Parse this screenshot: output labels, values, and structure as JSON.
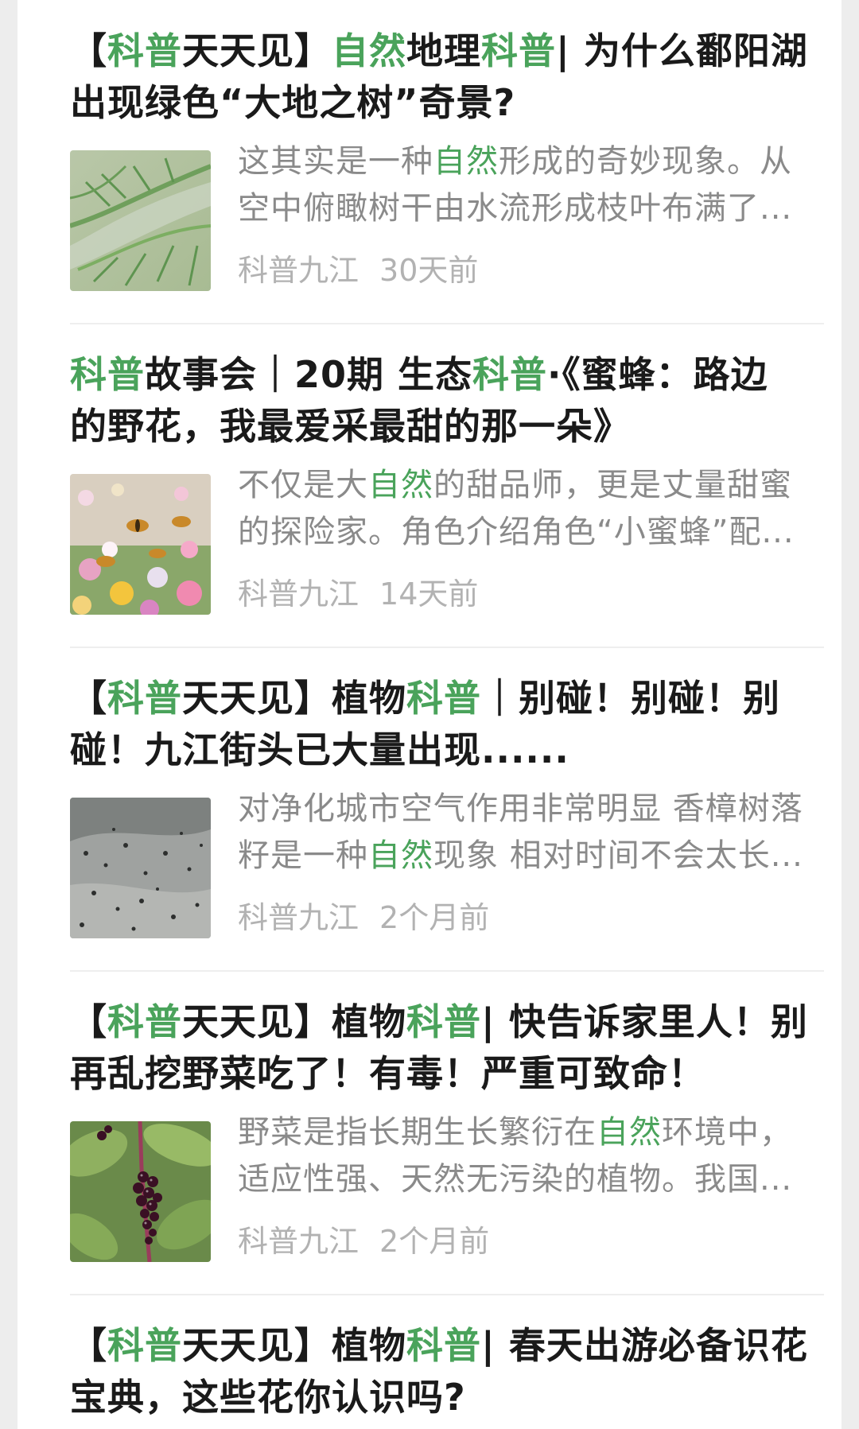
{
  "results": [
    {
      "title_lines": [
        [
          {
            "t": "【",
            "hl": false
          },
          {
            "t": "科普",
            "hl": true
          },
          {
            "t": "天天见】",
            "hl": false
          },
          {
            "t": "自然",
            "hl": true
          },
          {
            "t": "地理",
            "hl": false
          },
          {
            "t": "科普",
            "hl": true
          },
          {
            "t": "| 为什么鄱阳湖",
            "hl": false
          }
        ],
        [
          {
            "t": "出现绿色“大地之树”奇景?",
            "hl": false
          }
        ]
      ],
      "snippet_lines": [
        [
          {
            "t": "这其实是一种",
            "hl": false
          },
          {
            "t": "自然",
            "hl": true
          },
          {
            "t": "形成的奇妙现象。从",
            "hl": false
          }
        ],
        [
          {
            "t": "空中俯瞰树干由水流形成枝叶布满了...",
            "hl": false
          }
        ]
      ],
      "source": "科普九江",
      "time": "30天前",
      "thumbnail": "aerial-river-tree-pattern"
    },
    {
      "title_lines": [
        [
          {
            "t": "科普",
            "hl": true
          },
          {
            "t": "故事会｜20期 生态",
            "hl": false
          },
          {
            "t": "科普",
            "hl": true
          },
          {
            "t": "·《蜜蜂：路边",
            "hl": false
          }
        ],
        [
          {
            "t": "的野花，我最爱采最甜的那一朵》",
            "hl": false
          }
        ]
      ],
      "snippet_lines": [
        [
          {
            "t": "不仅是大",
            "hl": false
          },
          {
            "t": "自然",
            "hl": true
          },
          {
            "t": "的甜品师，更是丈量甜蜜",
            "hl": false
          }
        ],
        [
          {
            "t": "的探险家。角色介绍角色“小蜜蜂”配...",
            "hl": false
          }
        ]
      ],
      "source": "科普九江",
      "time": "14天前",
      "thumbnail": "bees-on-wildflowers"
    },
    {
      "title_lines": [
        [
          {
            "t": "【",
            "hl": false
          },
          {
            "t": "科普",
            "hl": true
          },
          {
            "t": "天天见】植物",
            "hl": false
          },
          {
            "t": "科普",
            "hl": true
          },
          {
            "t": "｜别碰！别碰！别",
            "hl": false
          }
        ],
        [
          {
            "t": "碰！九江街头已大量出现......",
            "hl": false
          }
        ]
      ],
      "snippet_lines": [
        [
          {
            "t": "对净化城市空气作用非常明显 香樟树落",
            "hl": false
          }
        ],
        [
          {
            "t": "籽是一种",
            "hl": false
          },
          {
            "t": "自然",
            "hl": true
          },
          {
            "t": "现象 相对时间不会太长...",
            "hl": false
          }
        ]
      ],
      "source": "科普九江",
      "time": "2个月前",
      "thumbnail": "seeds-on-pavement"
    },
    {
      "title_lines": [
        [
          {
            "t": "【",
            "hl": false
          },
          {
            "t": "科普",
            "hl": true
          },
          {
            "t": "天天见】植物",
            "hl": false
          },
          {
            "t": "科普",
            "hl": true
          },
          {
            "t": "| 快告诉家里人！别",
            "hl": false
          }
        ],
        [
          {
            "t": "再乱挖野菜吃了！有毒！严重可致命！",
            "hl": false
          }
        ]
      ],
      "snippet_lines": [
        [
          {
            "t": "野菜是指长期生长繁衍在",
            "hl": false
          },
          {
            "t": "自然",
            "hl": true
          },
          {
            "t": "环境中，",
            "hl": false
          }
        ],
        [
          {
            "t": "适应性强、天然无污染的植物。我国...",
            "hl": false
          }
        ]
      ],
      "source": "科普九江",
      "time": "2个月前",
      "thumbnail": "pokeweed-berries"
    },
    {
      "title_lines": [
        [
          {
            "t": "【",
            "hl": false
          },
          {
            "t": "科普",
            "hl": true
          },
          {
            "t": "天天见】植物",
            "hl": false
          },
          {
            "t": "科普",
            "hl": true
          },
          {
            "t": "| 春天出游必备识花",
            "hl": false
          }
        ],
        [
          {
            "t": "宝典，这些花你认识吗?",
            "hl": false
          }
        ]
      ],
      "snippet_lines": [],
      "source": "",
      "time": "",
      "thumbnail": ""
    }
  ],
  "colors": {
    "highlight": "#4aa35b",
    "title": "#1a1a1a",
    "snippet": "#8a8a8a",
    "meta": "#b2b2b2"
  }
}
